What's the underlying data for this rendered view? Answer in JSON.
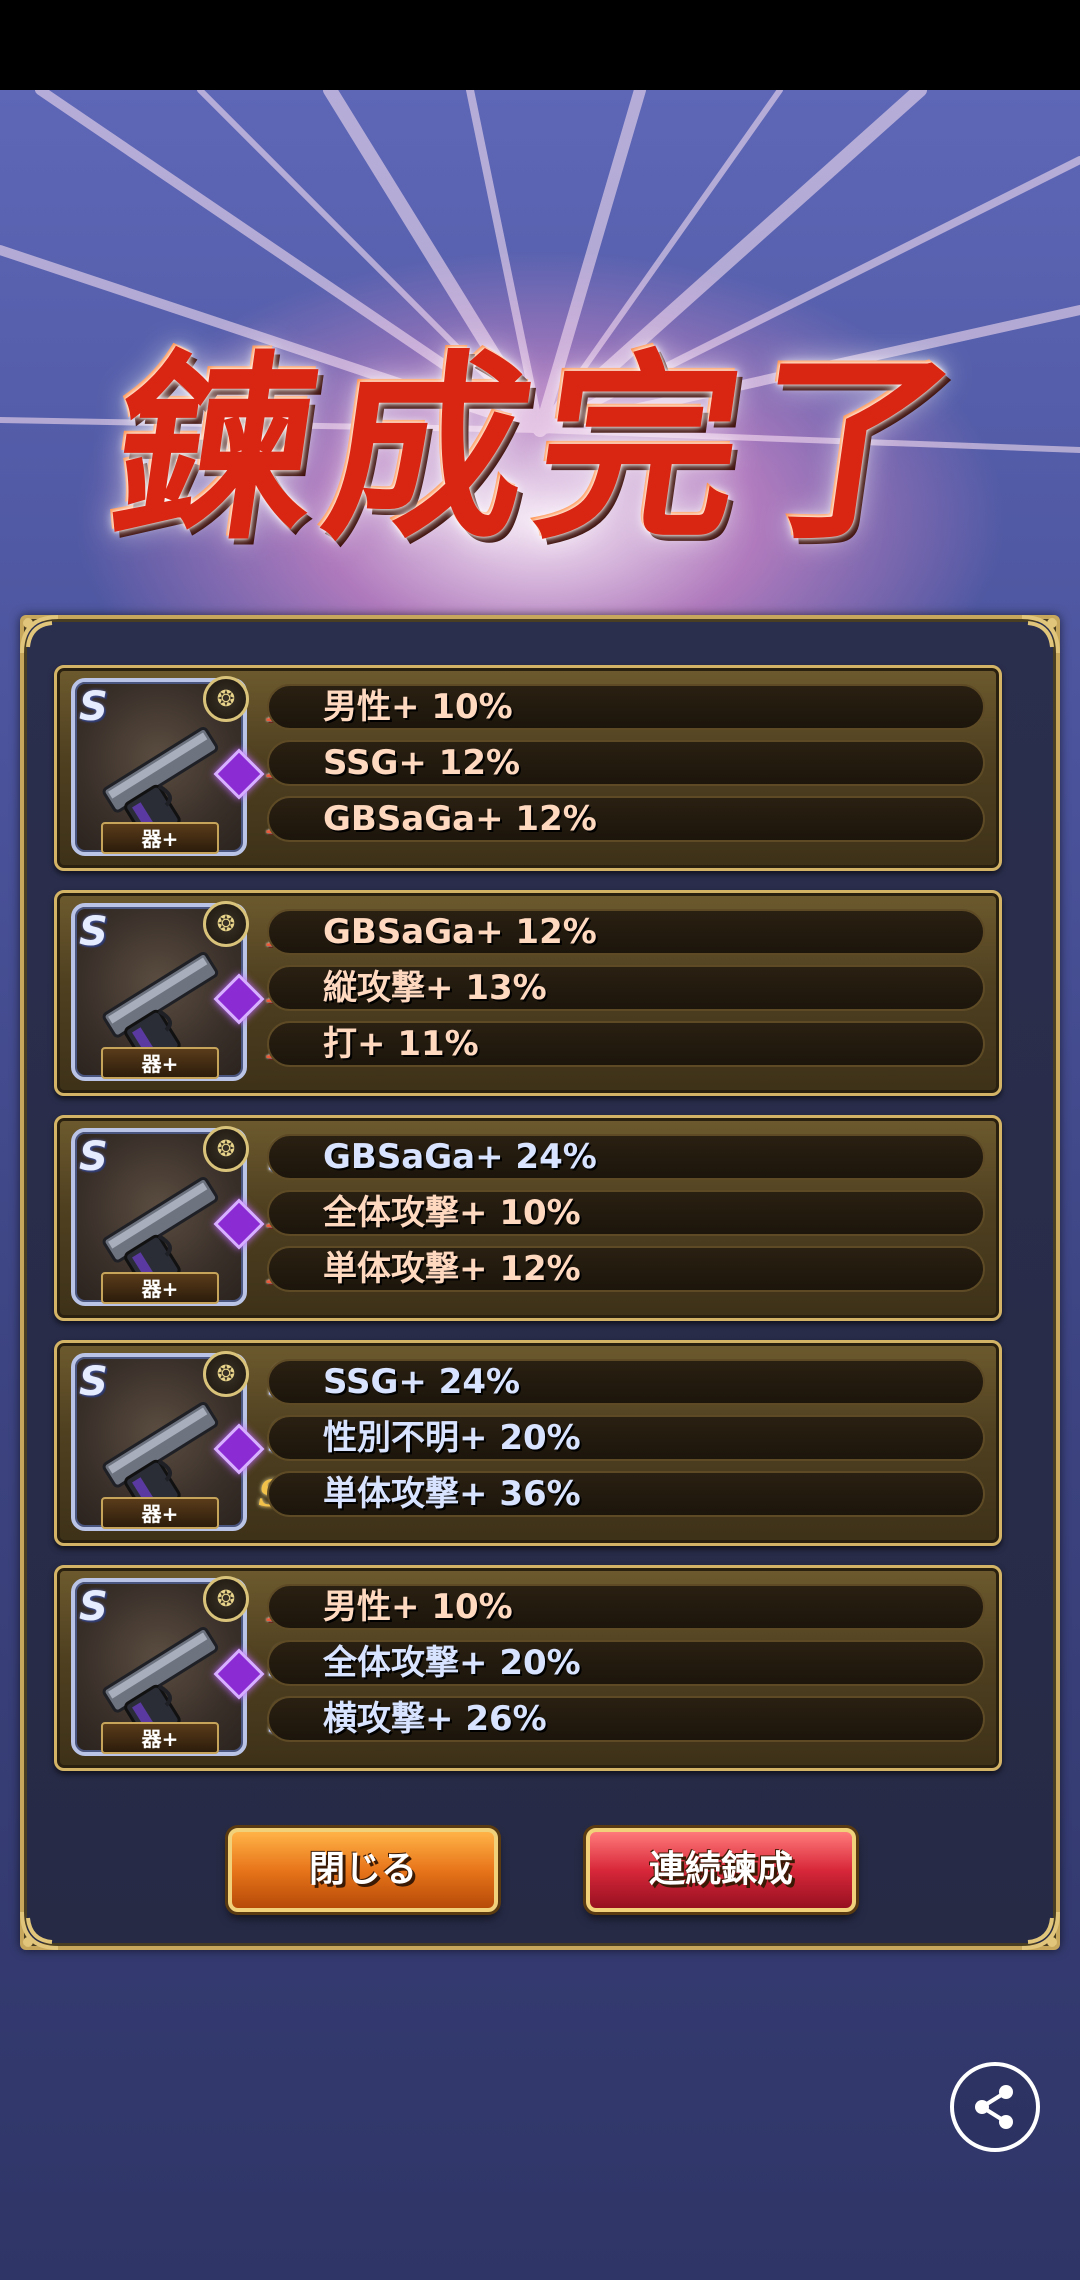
{
  "title": "鍊成完了",
  "items": [
    {
      "weapon_rank": "S",
      "tag": "器+",
      "abilities": [
        {
          "grade": "A",
          "text": "男性+ 10%"
        },
        {
          "grade": "A",
          "text": "SSG+ 12%"
        },
        {
          "grade": "A",
          "text": "GBSaGa+ 12%"
        }
      ]
    },
    {
      "weapon_rank": "S",
      "tag": "器+",
      "abilities": [
        {
          "grade": "A",
          "text": "GBSaGa+ 12%"
        },
        {
          "grade": "A",
          "text": "縦攻撃+ 13%"
        },
        {
          "grade": "A",
          "text": "打+ 11%"
        }
      ]
    },
    {
      "weapon_rank": "S",
      "tag": "器+",
      "abilities": [
        {
          "grade": "S",
          "text": "GBSaGa+ 24%"
        },
        {
          "grade": "A",
          "text": "全体攻撃+ 10%"
        },
        {
          "grade": "A",
          "text": "単体攻撃+ 12%"
        }
      ]
    },
    {
      "weapon_rank": "S",
      "tag": "器+",
      "abilities": [
        {
          "grade": "S",
          "text": "SSG+ 24%"
        },
        {
          "grade": "S",
          "text": "性別不明+ 20%"
        },
        {
          "grade": "SS",
          "text": "単体攻撃+ 36%"
        }
      ]
    },
    {
      "weapon_rank": "S",
      "tag": "器+",
      "abilities": [
        {
          "grade": "A",
          "text": "男性+ 10%"
        },
        {
          "grade": "S",
          "text": "全体攻撃+ 20%"
        },
        {
          "grade": "S",
          "text": "横攻撃+ 26%"
        }
      ]
    }
  ],
  "buttons": {
    "close_label": "閉じる",
    "continue_label": "連続鍊成"
  },
  "share_icon": "share-icon"
}
